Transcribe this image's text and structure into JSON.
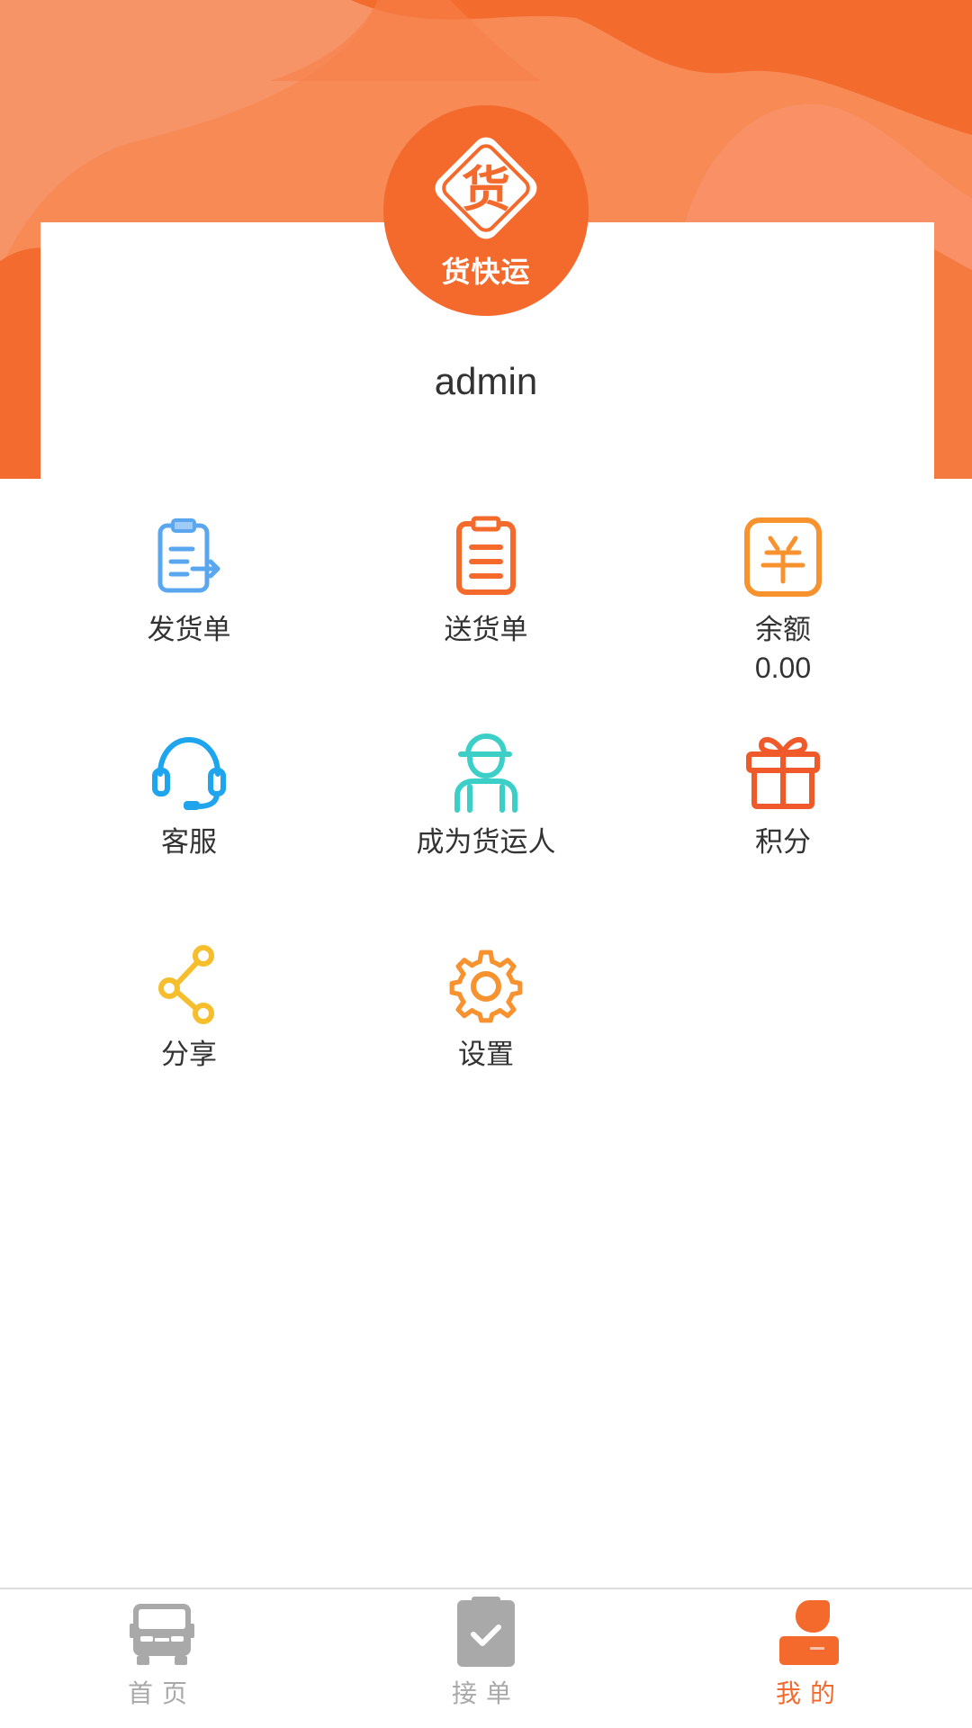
{
  "app": {
    "logo_name": "货快运",
    "logo_glyph": "货"
  },
  "profile": {
    "username": "admin"
  },
  "menu": [
    {
      "label": "发货单",
      "icon": "clipboard-arrow-icon"
    },
    {
      "label": "送货单",
      "icon": "clipboard-list-icon"
    },
    {
      "label": "余额",
      "value": "0.00",
      "icon": "yuan-wallet-icon"
    },
    {
      "label": "客服",
      "icon": "headset-icon"
    },
    {
      "label": "成为货运人",
      "icon": "courier-person-icon"
    },
    {
      "label": "积分",
      "icon": "gift-icon"
    },
    {
      "label": "分享",
      "icon": "share-icon"
    },
    {
      "label": "设置",
      "icon": "gear-icon"
    }
  ],
  "tabbar": [
    {
      "label": "首页",
      "icon": "truck-icon",
      "active": false
    },
    {
      "label": "接单",
      "icon": "clipboard-check-icon",
      "active": false
    },
    {
      "label": "我的",
      "icon": "user-icon",
      "active": true
    }
  ],
  "colors": {
    "brand": "#f46a2d",
    "inactive_tab": "#a9a9a9",
    "text": "#333333"
  }
}
